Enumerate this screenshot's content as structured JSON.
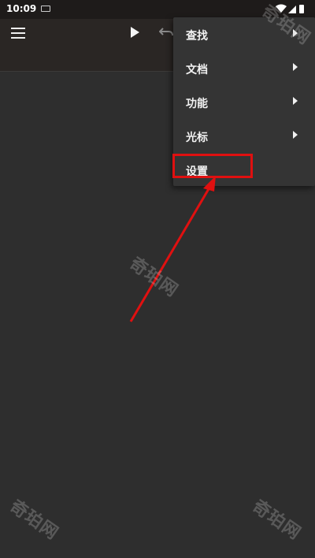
{
  "status_bar": {
    "time": "10:09"
  },
  "toolbar": {
    "menu_icon": "hamburger-icon",
    "play_icon": "play-icon",
    "undo_icon": "undo-icon"
  },
  "menu": {
    "items": [
      {
        "label": "查找",
        "has_submenu": true
      },
      {
        "label": "文档",
        "has_submenu": true
      },
      {
        "label": "功能",
        "has_submenu": true
      },
      {
        "label": "光标",
        "has_submenu": true
      },
      {
        "label": "设置",
        "has_submenu": false
      }
    ]
  },
  "annotation": {
    "color": "#e01010"
  },
  "watermark": {
    "text": "奇珀网"
  }
}
